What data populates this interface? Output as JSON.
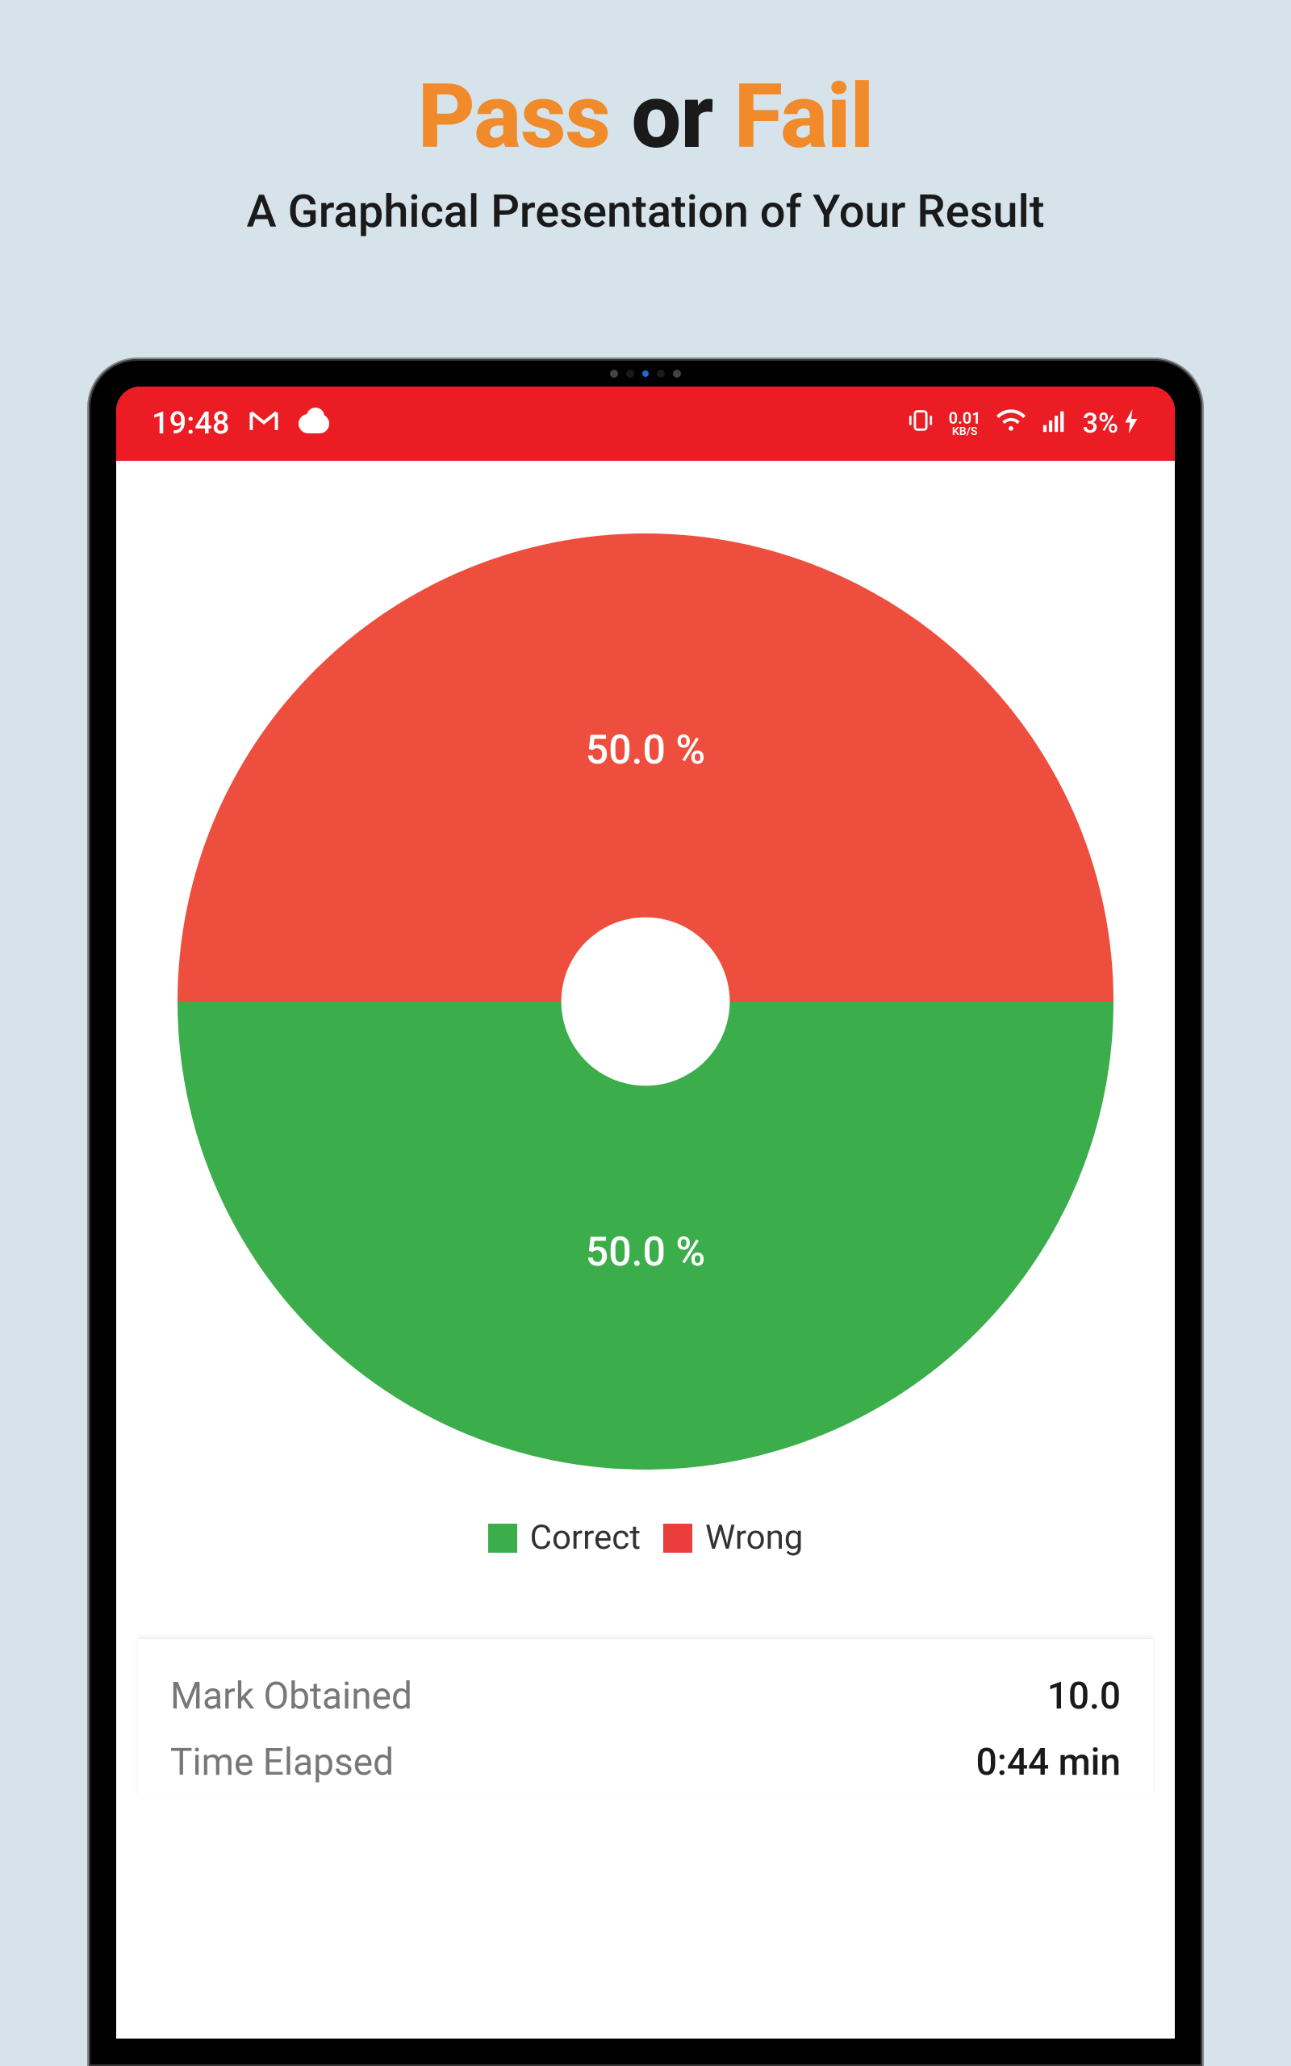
{
  "hero": {
    "pass": "Pass",
    "or": "or",
    "fail": "Fail",
    "subtitle": "A Graphical Presentation of Your Result"
  },
  "statusbar": {
    "time": "19:48",
    "net_speed_val": "0.01",
    "net_speed_unit": "KB/S",
    "battery_pct": "3%"
  },
  "chart": {
    "wrong_label": "50.0 %",
    "correct_label": "50.0 %"
  },
  "legend": {
    "correct": "Correct",
    "wrong": "Wrong"
  },
  "results": {
    "mark_label": "Mark Obtained",
    "mark_value": "10.0",
    "time_label": "Time Elapsed",
    "time_value": "0:44 min"
  },
  "chart_data": {
    "type": "pie",
    "title": "",
    "series": [
      {
        "name": "Wrong",
        "value": 50.0,
        "color": "#ee4e3d"
      },
      {
        "name": "Correct",
        "value": 50.0,
        "color": "#3cad4b"
      }
    ]
  }
}
